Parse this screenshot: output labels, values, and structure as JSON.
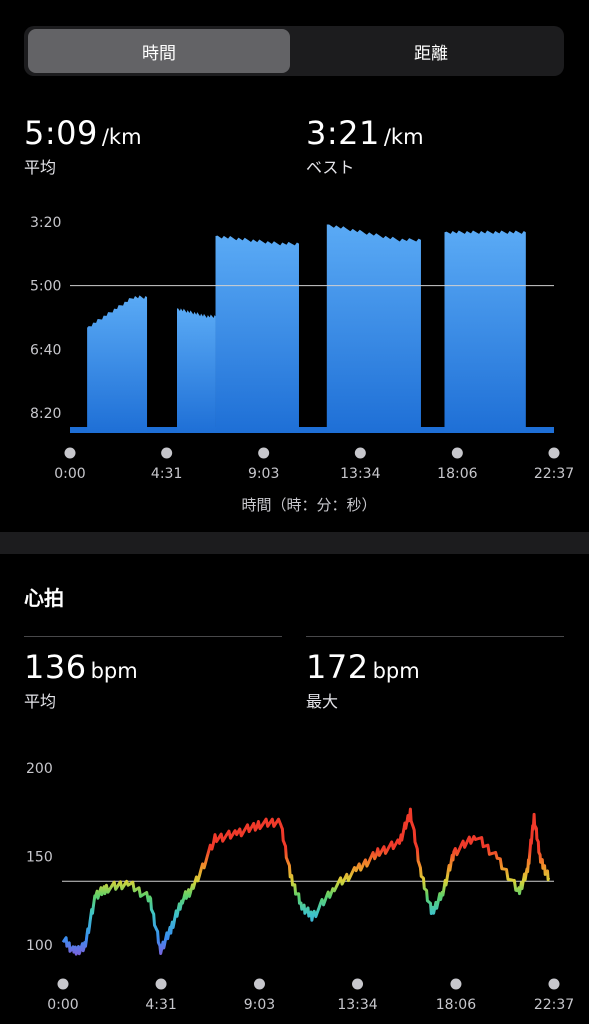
{
  "segmented": {
    "time_label": "時間",
    "distance_label": "距離",
    "selected": "time_label"
  },
  "pace": {
    "avg_value": "5:09",
    "avg_unit": "/km",
    "avg_label": "平均",
    "best_value": "3:21",
    "best_unit": "/km",
    "best_label": "ベスト"
  },
  "heart": {
    "title": "心拍",
    "avg_value": "136",
    "avg_unit": "bpm",
    "avg_label": "平均",
    "max_value": "172",
    "max_unit": "bpm",
    "max_label": "最大"
  },
  "colors": {
    "pace_fill_top": "#5aaaf5",
    "pace_fill_bottom": "#1e6fd6",
    "segment_active": "#636366"
  },
  "chart_data": [
    {
      "type": "area",
      "x_label": "時間（時：分：秒）",
      "x_ticks": [
        "0:00",
        "4:31",
        "9:03",
        "13:34",
        "18:06",
        "22:37"
      ],
      "y_ticks": [
        "3:20",
        "5:00",
        "6:40",
        "8:20"
      ],
      "y_unit": "min/km (pace, inverted axis)",
      "reference_line": "5:00",
      "segments": [
        {
          "x_start_min": 0.8,
          "x_end_min": 3.6,
          "pace_start_min": 6.1,
          "pace_end_min": 5.3
        },
        {
          "x_start_min": 5.0,
          "x_end_min": 6.8,
          "pace_start_min": 5.6,
          "pace_end_min": 5.8
        },
        {
          "x_start_min": 6.8,
          "x_end_min": 10.7,
          "pace_start_min": 3.7,
          "pace_end_min": 3.9
        },
        {
          "x_start_min": 12.0,
          "x_end_min": 16.4,
          "pace_start_min": 3.4,
          "pace_end_min": 3.8
        },
        {
          "x_start_min": 17.5,
          "x_end_min": 21.3,
          "pace_start_min": 3.6,
          "pace_end_min": 3.6
        }
      ]
    },
    {
      "type": "line",
      "x_ticks": [
        "0:00",
        "4:31",
        "9:03",
        "13:34",
        "18:06",
        "22:37"
      ],
      "y_ticks": [
        "200",
        "150",
        "100"
      ],
      "reference_line": 136,
      "x_min": [
        0,
        0.5,
        1.0,
        1.5,
        2.0,
        3.0,
        4.0,
        4.5,
        5.0,
        5.5,
        6.0,
        7.0,
        8.0,
        9.0,
        10.0,
        10.5,
        11.0,
        11.5,
        12.5,
        13.5,
        14.5,
        15.5,
        16.0,
        16.5,
        17.0,
        17.5,
        18.0,
        19.0,
        20.0,
        21.0,
        21.4,
        21.7,
        22.0,
        22.37
      ],
      "bpm": [
        104,
        96,
        99,
        128,
        132,
        135,
        126,
        97,
        110,
        126,
        132,
        160,
        163,
        168,
        170,
        138,
        122,
        116,
        133,
        142,
        152,
        158,
        175,
        140,
        118,
        130,
        152,
        162,
        149,
        130,
        142,
        172,
        148,
        138
      ]
    }
  ]
}
